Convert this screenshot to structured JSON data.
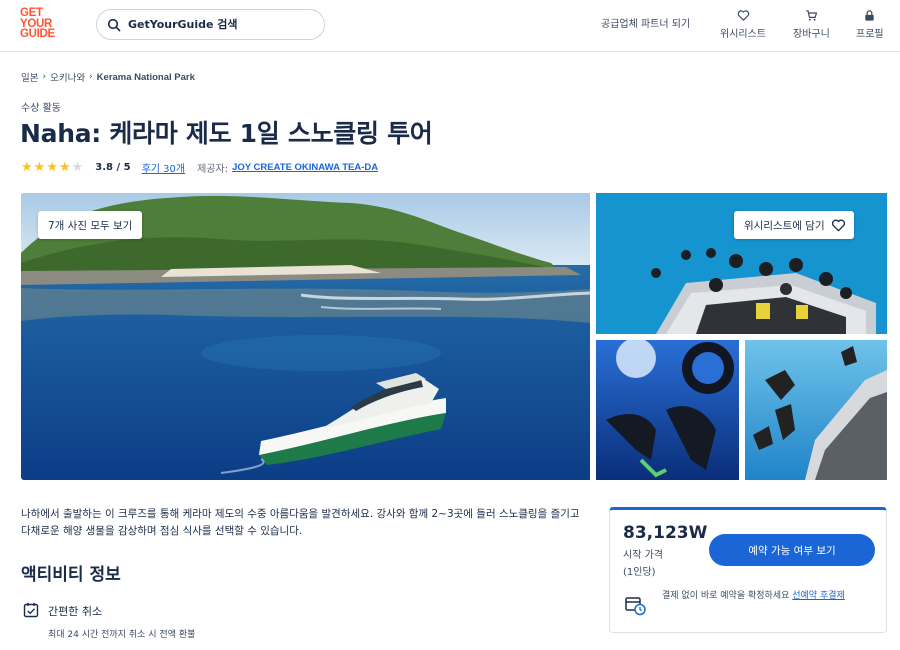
{
  "header": {
    "logo_line1": "GET",
    "logo_line2": "YOUR",
    "logo_line3": "GUIDE",
    "search_placeholder": "GetYourGuide 검색",
    "partner_link": "공급업체 파트너 되기",
    "wishlist_label": "위시리스트",
    "cart_label": "장바구니",
    "profile_label": "프로필"
  },
  "breadcrumb": [
    "일본",
    "오키나와",
    "Kerama National Park"
  ],
  "activity": {
    "category": "수상 활동",
    "title": "Naha: 케라마 제도 1일 스노클링 투어",
    "rating_value": "3.8 / 5",
    "rating_stars": 3.8,
    "reviews_link": "후기 30개",
    "provider_label": "제공자:",
    "provider_name": "JOY CREATE OKINAWA TEA-DA"
  },
  "gallery": {
    "show_all_label": "7개 사진 모두 보기",
    "wishlist_button_label": "위시리스트에 담기"
  },
  "description": "나하에서 출발하는 이 크루즈를 통해 케라마 제도의 수중 아름다움을 발견하세요. 강사와 함께 2~3곳에 들러 스노클링을 즐기고 다채로운 해양 생물을 감상하며 점심 식사를 선택할 수 있습니다.",
  "info": {
    "section_title": "액티비티 정보",
    "feature_title": "간편한 취소",
    "feature_desc": "최대 24 시간 전까지 취소 시 전액 환불"
  },
  "booking": {
    "price": "83,123W",
    "price_label": "시작 가격",
    "price_unit": "(1인당)",
    "check_button": "예약 가능 여부 보기",
    "note_text": "결제 없이 바로 예약을 확정하세요",
    "note_link": "선예약 후결제"
  },
  "colors": {
    "brand": "#ff5533",
    "primary_blue": "#1a66d6",
    "star": "#fdc11c",
    "text_dark": "#1a2b49"
  },
  "icons": [
    "search-icon",
    "heart-icon",
    "cart-icon",
    "profile-icon",
    "calendar-check-icon",
    "calendar-clock-icon"
  ]
}
